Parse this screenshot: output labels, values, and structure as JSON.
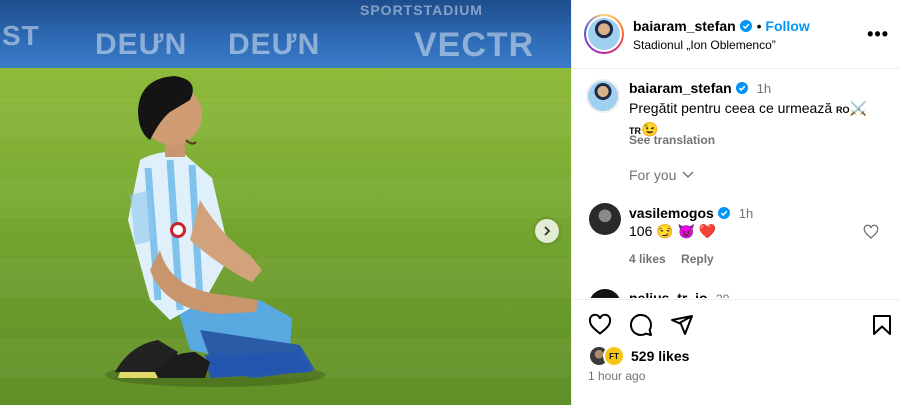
{
  "post_image": {
    "stand_banners": [
      "ST",
      "DEƯN",
      "DEƯN",
      "VECTR",
      "SPORTSTADIUM"
    ]
  },
  "header": {
    "username": "baiaram_stefan",
    "follow_label": "Follow",
    "location": "Stadionul „Ion Oblemenco”",
    "more_label": "•••"
  },
  "caption": {
    "username": "baiaram_stefan",
    "time": "1h",
    "text_line1": "Pregătit pentru ceea ce urmează",
    "flag1": "RO",
    "emoji1": "⚔️",
    "flag2": "TR",
    "emoji2": "😉",
    "see_translation": "See translation"
  },
  "for_you": "For you",
  "comment": {
    "username": "vasilemogos",
    "time": "1h",
    "text": "106",
    "emojis": [
      "😏",
      "😈",
      "❤️"
    ],
    "likes": "4 likes",
    "reply": "Reply",
    "next_username_partial": "nelius_tr_io",
    "next_time_partial": "39"
  },
  "actions": {
    "likes_badge": "FT",
    "likes_count": "529 likes",
    "time_ago": "1 hour ago"
  },
  "colors": {
    "link_blue": "#0095f6",
    "verified_blue": "#0095f6",
    "heart_red": "#ed4956",
    "grey": "#737373"
  }
}
